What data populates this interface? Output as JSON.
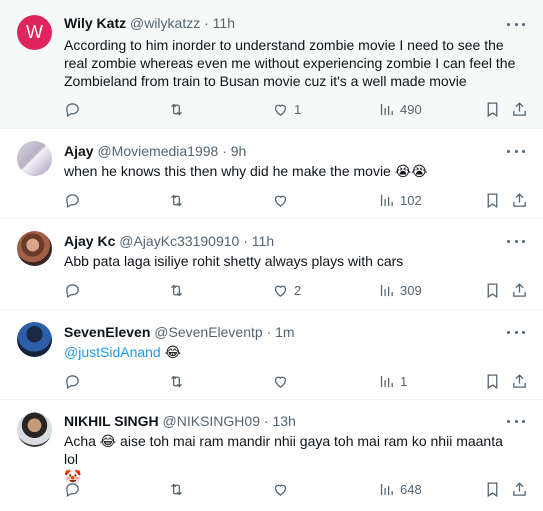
{
  "tweets": [
    {
      "avatar_letter": "W",
      "name": "Wily Katz",
      "handle": "@wilykatzz",
      "time": "11h",
      "text": "According to him inorder to understand zombie movie I need to see the real zombie whereas even me without experiencing zombie I can feel the Zombieland from train to Busan movie cuz it's a well made movie",
      "likes": "1",
      "views": "490"
    },
    {
      "name": "Ajay",
      "handle": "@Moviemedia1998",
      "time": "9h",
      "text": "when he knows this then why did he make the movie 😭😭",
      "likes": "",
      "views": "102"
    },
    {
      "name": "Ajay Kc",
      "handle": "@AjayKc33190910",
      "time": "11h",
      "text": "Abb pata laga isiliye rohit shetty always plays with cars",
      "likes": "2",
      "views": "309"
    },
    {
      "name": "SevenEleven",
      "handle": "@SevenEleventp",
      "time": "1m",
      "mention": "@justSidAnand",
      "text": " 😂",
      "likes": "",
      "views": "1"
    },
    {
      "name": "NIKHIL SINGH",
      "handle": "@NIKSINGH09",
      "time": "13h",
      "text": "Acha 😂 aise toh mai ram mandir nhii gaya toh mai ram ko nhii maanta lol",
      "text2": "🤡",
      "likes": "",
      "views": "648"
    }
  ],
  "separator": "·",
  "colors": {
    "accent": "#1d9bf0",
    "muted": "#536471",
    "text": "#0f1419",
    "avatar_w": "#e0245e"
  }
}
